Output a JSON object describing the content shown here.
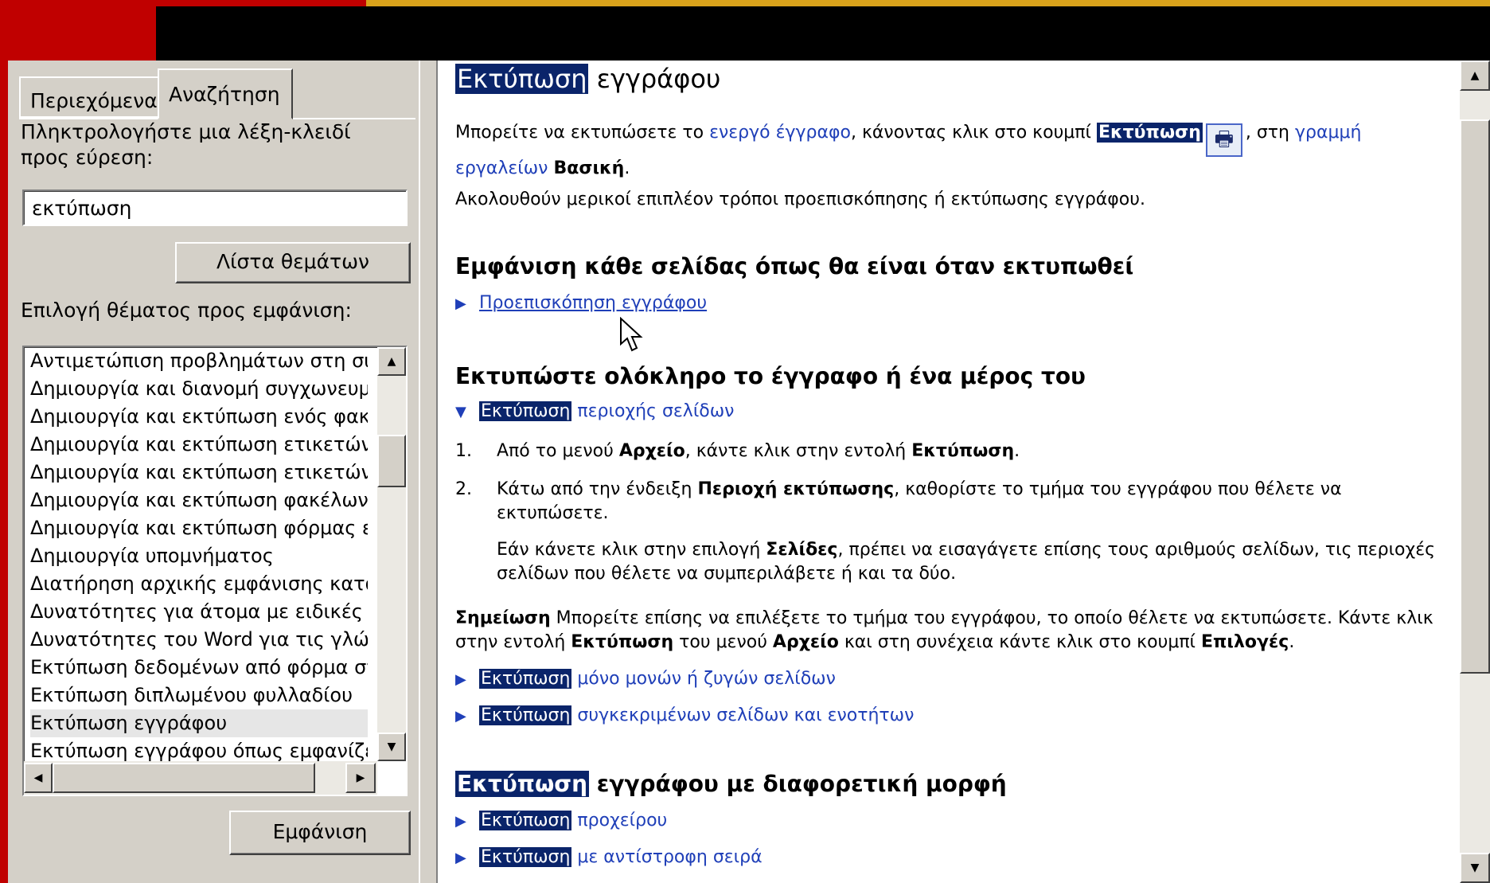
{
  "tabs": {
    "contents": "Περιεχόμενα",
    "search": "Αναζήτηση"
  },
  "search": {
    "keyword_label": "Πληκτρολογήστε μια λέξη-κλειδί προς εύρεση:",
    "keyword_value": "εκτύπωση",
    "list_topics_button": "Λίστα θεμάτων",
    "topic_label": "Επιλογή θέματος προς εμφάνιση:",
    "topics": [
      "Αντιμετώπιση προβλημάτων στη συγχώνευση",
      "Δημιουργία και διανομή συγχωνευμένων",
      "Δημιουργία και εκτύπωση ενός φακέλου",
      "Δημιουργία και εκτύπωση ετικετών για",
      "Δημιουργία και εκτύπωση ετικετών για",
      "Δημιουργία και εκτύπωση φακέλων για",
      "Δημιουργία και εκτύπωση φόρμας επ",
      "Δημιουργία υπομνήματος",
      "Διατήρηση αρχικής εμφάνισης κατά τη",
      "Δυνατότητες για άτομα με ειδικές ανάγκες",
      "Δυνατότητες του Word για τις γλώσσες",
      "Εκτύπωση δεδομένων από φόρμα στο",
      "Εκτύπωση διπλωμένου φυλλαδίου",
      "Εκτύπωση εγγράφου",
      "Εκτύπωση εγγράφου όπως εμφανίζεται"
    ],
    "selected_topic_index": 13,
    "show_button": "Εμφάνιση"
  },
  "article": {
    "highlight_word": "Εκτύπωση",
    "title_rest": " εγγράφου",
    "intro_1": "Μπορείτε να εκτυπώσετε το ",
    "intro_link_1": "ενεργό έγγραφο",
    "intro_2": ", κάνοντας κλικ στο κουμπί ",
    "intro_3": ", στη ",
    "intro_link_2": "γραμμή εργαλείων",
    "intro_bold": "Βασική",
    "intro_end": ".",
    "line_2": "Ακολουθούν μερικοί επιπλέον τρόποι προεπισκόπησης ή εκτύπωσης εγγράφου.",
    "h_preview": "Εμφάνιση κάθε σελίδας όπως θα είναι όταν εκτυπωθεί",
    "preview_link": "Προεπισκόπηση εγγράφου",
    "h_print_part": "Εκτυπώστε ολόκληρο το έγγραφο ή ένα μέρος του",
    "range_rest": " περιοχής σελίδων",
    "step1_num": "1.",
    "step1_a": "Από το μενού ",
    "step1_b": "Αρχείο",
    "step1_c": ", κάντε κλικ στην εντολή ",
    "step1_d": "Εκτύπωση",
    "step1_e": ".",
    "step2_num": "2.",
    "step2_a": "Κάτω από την ένδειξη ",
    "step2_b": "Περιοχή εκτύπωσης",
    "step2_c": ", καθορίστε το τμήμα του εγγράφου που θέλετε να εκτυπώσετε.",
    "step2_note_a": "Εάν κάνετε κλικ στην επιλογή ",
    "step2_note_b": "Σελίδες",
    "step2_note_c": ", πρέπει να εισαγάγετε επίσης τους αριθμούς σελίδων, τις περιοχές σελίδων που θέλετε να συμπεριλάβετε ή και τα δύο.",
    "note_label": "Σημείωση",
    "note_a": "  Μπορείτε επίσης να επιλέξετε το τμήμα του εγγράφου, το οποίο θέλετε να εκτυπώσετε. Κάντε κλικ στην εντολή ",
    "note_b": "Εκτύπωση",
    "note_c": " του μενού ",
    "note_d": "Αρχείο",
    "note_e": " και στη συνέχεια κάντε κλικ στο κουμπί ",
    "note_f": "Επιλογές",
    "note_g": ".",
    "odd_even_rest": " μόνο μονών ή ζυγών σελίδων",
    "sections_rest": " συγκεκριμένων σελίδων και ενοτήτων",
    "h_other_rest": " εγγράφου με διαφορετική μορφή",
    "draft_rest": " προχείρου",
    "reverse_rest": " με αντίστροφη σειρά"
  }
}
